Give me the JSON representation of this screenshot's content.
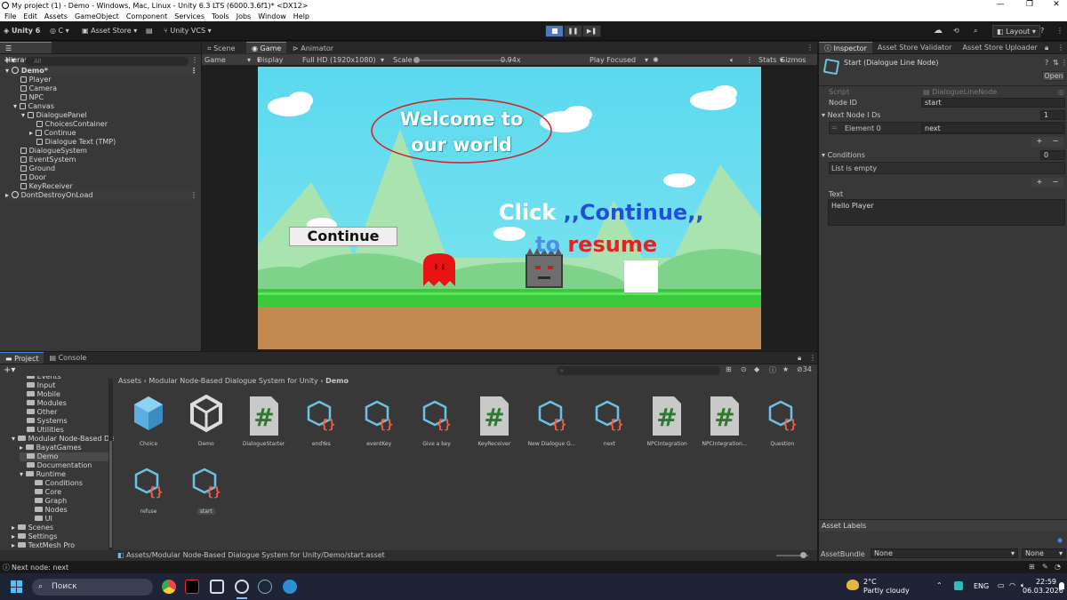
{
  "window": {
    "title": "My project (1) - Demo - Windows, Mac, Linux - Unity 6.3 LTS (6000.3.6f1)* <DX12>",
    "controls": [
      "—",
      "❐",
      "✕"
    ]
  },
  "menu": [
    "File",
    "Edit",
    "Assets",
    "GameObject",
    "Component",
    "Services",
    "Tools",
    "Jobs",
    "Window",
    "Help"
  ],
  "toolbar": {
    "unity_label": "Unity 6",
    "account_label": "C",
    "asset_store": "Asset Store",
    "vcs": "Unity VCS",
    "layout": "Layout"
  },
  "hierarchy": {
    "tab": "Hierarchy",
    "search_placeholder": "All",
    "items": [
      {
        "label": "Demo*",
        "depth": 0,
        "kind": "scene"
      },
      {
        "label": "Player",
        "depth": 1,
        "kind": "go"
      },
      {
        "label": "Camera",
        "depth": 1,
        "kind": "go"
      },
      {
        "label": "NPC",
        "depth": 1,
        "kind": "go"
      },
      {
        "label": "Canvas",
        "depth": 1,
        "kind": "go"
      },
      {
        "label": "DialoguePanel",
        "depth": 2,
        "kind": "go"
      },
      {
        "label": "ChoicesContainer",
        "depth": 3,
        "kind": "go"
      },
      {
        "label": "Continue",
        "depth": 3,
        "kind": "go"
      },
      {
        "label": "Dialogue Text (TMP)",
        "depth": 3,
        "kind": "go"
      },
      {
        "label": "DialogueSystem",
        "depth": 1,
        "kind": "go"
      },
      {
        "label": "EventSystem",
        "depth": 1,
        "kind": "go"
      },
      {
        "label": "Ground",
        "depth": 1,
        "kind": "go"
      },
      {
        "label": "Door",
        "depth": 1,
        "kind": "go"
      },
      {
        "label": "KeyReceiver",
        "depth": 1,
        "kind": "go"
      },
      {
        "label": "DontDestroyOnLoad",
        "depth": 0,
        "kind": "scene"
      }
    ]
  },
  "center_tabs": [
    "Scene",
    "Game",
    "Animator"
  ],
  "game_toolbar": {
    "mode": "Game",
    "display": "Display 1",
    "resolution": "Full HD (1920x1080)",
    "scale_label": "Scale",
    "scale_value": "0.94x",
    "play_focused": "Play Focused",
    "stats": "Stats",
    "gizmos": "Gizmos"
  },
  "game_view": {
    "bubble_text_line1": "Welcome to",
    "bubble_text_line2": "our world",
    "continue_button": "Continue",
    "hint_click": "Click",
    "hint_continue": ",,Continue,,",
    "hint_to": "to",
    "hint_resume": "resume"
  },
  "inspector": {
    "tabs": [
      "Inspector",
      "Asset Store Validator",
      "Asset Store Uploader"
    ],
    "title": "Start (Dialogue Line Node)",
    "open_button": "Open",
    "script_label": "Script",
    "script_value": "DialogueLineNode",
    "node_id_label": "Node ID",
    "node_id_value": "start",
    "next_ids_label": "Next Node I Ds",
    "next_ids_count": "1",
    "element0_label": "Element 0",
    "element0_value": "next",
    "conditions_label": "Conditions",
    "conditions_count": "0",
    "conditions_empty": "List is empty",
    "text_label": "Text",
    "text_value": "Hello Player",
    "asset_labels": "Asset Labels",
    "assetbundle_label": "AssetBundle",
    "assetbundle_value": "None",
    "assetbundle_variant": "None"
  },
  "project": {
    "tabs": [
      "Project",
      "Console"
    ],
    "hidden_count": "34",
    "breadcrumb": [
      "Assets",
      "Modular Node-Based Dialogue System for Unity",
      "Demo"
    ],
    "tree": [
      {
        "label": "Events",
        "depth": 2
      },
      {
        "label": "Input",
        "depth": 2
      },
      {
        "label": "Mobile",
        "depth": 2
      },
      {
        "label": "Modules",
        "depth": 2
      },
      {
        "label": "Other",
        "depth": 2
      },
      {
        "label": "Systems",
        "depth": 2
      },
      {
        "label": "Utilities",
        "depth": 2
      },
      {
        "label": "Modular Node-Based Dial",
        "depth": 1
      },
      {
        "label": "BayatGames",
        "depth": 2
      },
      {
        "label": "Demo",
        "depth": 2
      },
      {
        "label": "Documentation",
        "depth": 2
      },
      {
        "label": "Runtime",
        "depth": 2
      },
      {
        "label": "Conditions",
        "depth": 3
      },
      {
        "label": "Core",
        "depth": 3
      },
      {
        "label": "Graph",
        "depth": 3
      },
      {
        "label": "Nodes",
        "depth": 3
      },
      {
        "label": "UI",
        "depth": 3
      },
      {
        "label": "Scenes",
        "depth": 1
      },
      {
        "label": "Settings",
        "depth": 1
      },
      {
        "label": "TextMesh Pro",
        "depth": 1
      },
      {
        "label": "Packages",
        "depth": 0
      }
    ],
    "assets": [
      {
        "label": "Choice",
        "icon": "prefab"
      },
      {
        "label": "Demo",
        "icon": "unity-scene"
      },
      {
        "label": "DialogueStarter",
        "icon": "cs-script"
      },
      {
        "label": "endYes",
        "icon": "node-asset"
      },
      {
        "label": "eventKey",
        "icon": "node-asset"
      },
      {
        "label": "Give a key",
        "icon": "node-asset"
      },
      {
        "label": "KeyReceiver",
        "icon": "cs-script"
      },
      {
        "label": "New Dialogue G...",
        "icon": "node-asset"
      },
      {
        "label": "next",
        "icon": "node-asset"
      },
      {
        "label": "NPCIntegration",
        "icon": "cs-script"
      },
      {
        "label": "NPCIntegration...",
        "icon": "cs-script"
      },
      {
        "label": "Question",
        "icon": "node-asset"
      },
      {
        "label": "refuse",
        "icon": "node-asset"
      },
      {
        "label": "start",
        "icon": "node-asset"
      }
    ],
    "path": "Assets/Modular Node-Based Dialogue System for Unity/Demo/start.asset"
  },
  "status_bar": "Next node: next",
  "taskbar": {
    "search": "Поиск",
    "weather_temp": "2°C",
    "weather_desc": "Partly cloudy",
    "lang": "ENG",
    "time": "22:59",
    "date": "06.03.2026"
  }
}
